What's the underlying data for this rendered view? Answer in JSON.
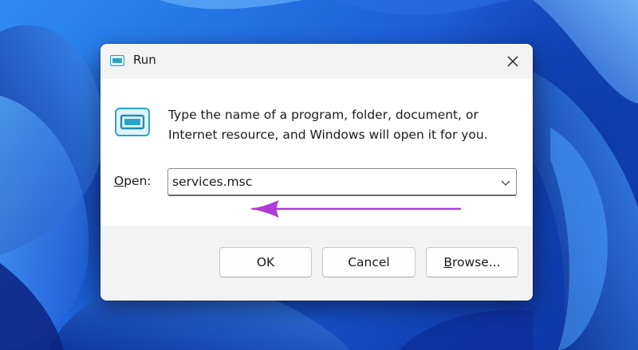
{
  "dialog": {
    "title": "Run",
    "icon": "run-icon",
    "close_icon": "close-icon",
    "description_line1": "Type the name of a program, folder, document, or",
    "description_line2": "Internet resource, and Windows will open it for you.",
    "open_label_access_key": "O",
    "open_label_rest": "pen:",
    "open_value": "services.msc",
    "dropdown_icon": "chevron-down-icon",
    "annotation": {
      "icon": "arrow-left-icon",
      "color": "#b03ad6"
    }
  },
  "buttons": {
    "ok": "OK",
    "cancel": "Cancel",
    "browse_access_key": "B",
    "browse_rest": "rowse..."
  },
  "colors": {
    "wallpaper": "#1f6fe0",
    "dialog_bg": "#ffffff",
    "footer_bg": "#f3f3f3",
    "icon_accent": "#2aa3c9"
  }
}
